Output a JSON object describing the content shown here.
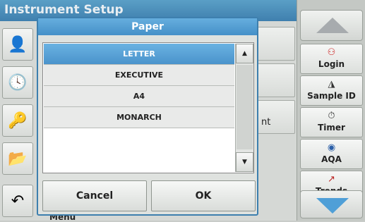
{
  "background": {
    "title": "Instrument Setup",
    "peek_text_right": "nt",
    "peek_text_bottom": "Menu"
  },
  "dialog": {
    "title": "Paper",
    "options": [
      "LETTER",
      "EXECUTIVE",
      "A4",
      "MONARCH"
    ],
    "selected": "LETTER",
    "cancel_label": "Cancel",
    "ok_label": "OK"
  },
  "right_panel": {
    "buttons": [
      {
        "label": "Login",
        "icon": "person-icon"
      },
      {
        "label": "Sample ID",
        "icon": "sample-icon"
      },
      {
        "label": "Timer",
        "icon": "timer-icon"
      },
      {
        "label": "AQA",
        "icon": "aqa-icon"
      },
      {
        "label": "Trends",
        "icon": "trends-icon"
      }
    ]
  },
  "colors": {
    "accent": "#4a93cb",
    "title_bar": "#3f7fae",
    "scroll_down_arrow": "#4f9fd7"
  }
}
